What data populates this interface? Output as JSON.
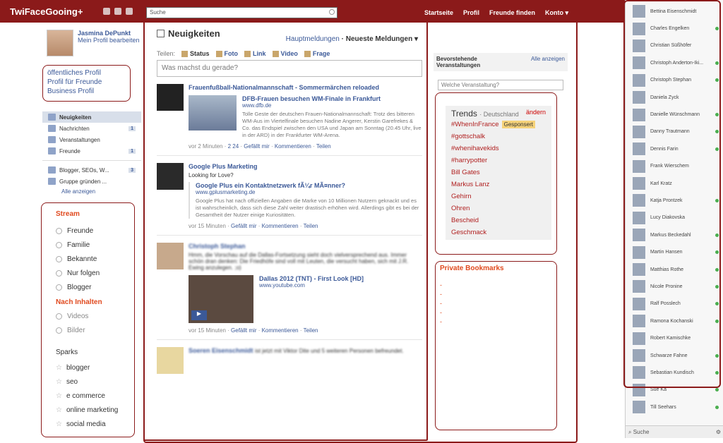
{
  "header": {
    "logo": "TwiFaceGooing+",
    "search_placeholder": "Suche",
    "nav": [
      "Startseite",
      "Profil",
      "Freunde finden",
      "Konto ▾"
    ]
  },
  "profile": {
    "name": "Jasmina DePunkt",
    "edit": "Mein Profil bearbeiten"
  },
  "profile_links": [
    "öffentliches Profil",
    "Profil für Freunde",
    "Business Profil"
  ],
  "nav": [
    {
      "label": "Neuigkeiten",
      "count": ""
    },
    {
      "label": "Nachrichten",
      "count": "1"
    },
    {
      "label": "Veranstaltungen",
      "count": ""
    },
    {
      "label": "Freunde",
      "count": "1"
    }
  ],
  "groups": [
    {
      "label": "Blogger, SEOs, W...",
      "count": "3"
    },
    {
      "label": "Gruppe gründen ...",
      "count": ""
    }
  ],
  "show_all": "Alle anzeigen",
  "stream": {
    "heading": "Stream",
    "items": [
      "Freunde",
      "Familie",
      "Bekannte",
      "Nur folgen",
      "Blogger"
    ],
    "content_heading": "Nach Inhalten",
    "content_items": [
      "Videos",
      "Bilder"
    ],
    "sparks_heading": "Sparks",
    "sparks": [
      "blogger",
      "seo",
      "e commerce",
      "online marketing",
      "social media"
    ]
  },
  "feed": {
    "title": "Neuigkeiten",
    "sort_main": "Hauptmeldungen",
    "sort_dot": " · ",
    "sort_recent": "Neueste Meldungen ▾",
    "share_label": "Teilen:",
    "share": [
      "Status",
      "Foto",
      "Link",
      "Video",
      "Frage"
    ],
    "composer_placeholder": "Was machst du gerade?"
  },
  "posts": [
    {
      "title": "Frauenfußball-Nationalmannschaft - Sommermärchen reloaded",
      "text": "",
      "att_title": "DFB-Frauen besuchen WM-Finale in Frankfurt",
      "att_url": "www.dfb.de",
      "att_desc": "Tolle Geste der deutschen Frauen-Nationalmannschaft: Trotz des bitteren WM-Aus im Viertelfinale besuchen Nadine Angerer, Kerstin Garefrekes & Co. das Endspiel zwischen den USA und Japan am Sonntag (20.45 Uhr, live in der ARD) in der Frankfurter WM-Arena.",
      "meta": "vor 2 Minuten · ",
      "c1": "2",
      "c2": "24",
      "likes": "Gefällt mir",
      "comments": "Kommentieren",
      "share": "Teilen"
    },
    {
      "title": "Google Plus Marketing",
      "text": "Looking for Love?",
      "att_title": "Google Plus ein Kontaktnetzwerk fÃ¼r MÃ¤nner?",
      "att_url": "www.gplusmarketing.de",
      "att_desc": "Google Plus hat nach offiziellen Angaben die Marke von 10 Millionen Nutzern geknackt und es ist wahrscheinlich, dass sich diese Zahl weiter drastisch erhöhen wird. Allerdings gibt es bei der Gesamtheit der Nutzer einige Kuriositäten.",
      "meta": "vor 15 Minuten · ",
      "likes": "Gefällt mir",
      "comments": "Kommentieren",
      "share": "Teilen"
    },
    {
      "title": "Christoph Stephan",
      "text": "Hmm, die Vorschau auf die Dallas-Fortsetzung sieht doch vielversprechend aus. Immer schön dran denken: Die Friedhöfe sind voll mit Leuten, die versucht haben, sich mit J.R. Ewing anzulegen. ;o)",
      "att_title": "Dallas 2012 (TNT) - First Look [HD]",
      "att_url": "www.youtube.com",
      "meta": "vor 15 Minuten · ",
      "likes": "Gefällt mir",
      "comments": "Kommentieren",
      "share": "Teilen"
    },
    {
      "title": "Soeren Eisenschmidt",
      "text": "ist jetzt mit Viktor Dite und 5 weiteren Personen befreundet."
    }
  ],
  "events": {
    "heading": "Bevorstehende Veranstaltungen",
    "show_all": "Alle anzeigen",
    "placeholder": "Welche Veranstaltung?"
  },
  "trends": {
    "title": "Trends",
    "location": "· Deutschland",
    "change": "ändern",
    "sponsored": "Gesponsert",
    "items": [
      "#WhenInFrance",
      "#gottschalk",
      "#whenihavekids",
      "#harrypotter",
      "Bill Gates",
      "Markus Lanz",
      "Gehirn",
      "Ohren",
      "Bescheid",
      "Geschmack"
    ]
  },
  "bookmarks": {
    "title": "Private Bookmarks",
    "items": [
      "-",
      "-",
      "-",
      "-",
      "-"
    ]
  },
  "chat": {
    "friends": [
      {
        "name": "Bettina Eisenschmidt",
        "online": false
      },
      {
        "name": "Charles Engelken",
        "online": true
      },
      {
        "name": "Christian Süßhöfer",
        "online": false
      },
      {
        "name": "Christoph Anderton-Iki...",
        "online": true
      },
      {
        "name": "Christoph Stephan",
        "online": true
      },
      {
        "name": "Daniela Zyck",
        "online": false
      },
      {
        "name": "Danielle Wünschmann",
        "online": true
      },
      {
        "name": "Danny Trautmann",
        "online": true
      },
      {
        "name": "Dennis Farin",
        "online": true
      },
      {
        "name": "Frank Wierschem",
        "online": false
      },
      {
        "name": "Karl Kratz",
        "online": false
      },
      {
        "name": "Katja Prontzek",
        "online": true
      },
      {
        "name": "Lucy Diakovska",
        "online": false
      },
      {
        "name": "Markus Beckedahl",
        "online": true
      },
      {
        "name": "Martin Hansen",
        "online": true
      },
      {
        "name": "Matthias Rothe",
        "online": true
      },
      {
        "name": "Nicole Pronine",
        "online": true
      },
      {
        "name": "Ralf Posslech",
        "online": true
      },
      {
        "name": "Ramona Kochanski",
        "online": true
      },
      {
        "name": "Robert Kamischke",
        "online": false
      },
      {
        "name": "Schwarze Fahne",
        "online": true
      },
      {
        "name": "Sebastian Kundisch",
        "online": true
      },
      {
        "name": "Sue Ka",
        "online": true
      },
      {
        "name": "Till Seehars",
        "online": true
      }
    ],
    "search": "Suche"
  }
}
